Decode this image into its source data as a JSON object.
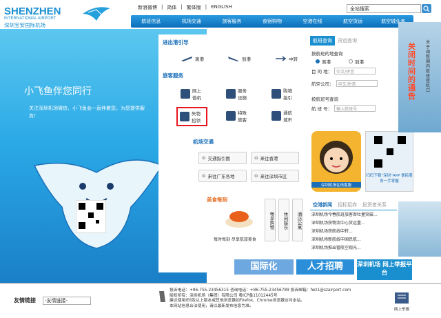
{
  "header": {
    "logo_en": "SHENZHEN",
    "logo_sub": "INTERNATIONAL AIRPORT",
    "logo_cn": "深圳宝安国际机场",
    "top_links": [
      "新浪微博",
      "简体",
      "繁体版",
      "ENGLISH"
    ],
    "search_placeholder": "全站搜索"
  },
  "main_nav": [
    "航班信息",
    "机场交通",
    "旅客服务",
    "食宿购物",
    "空港在线",
    "航空货运",
    "航空城业务"
  ],
  "hero": {
    "title": "小飞鱼伴您同行",
    "subtitle": "关注深圳机场微信、小飞鱼会一直伴着您，为您提供服务！"
  },
  "guide": {
    "title": "进出港引导",
    "items": [
      "离港",
      "到港",
      "中转"
    ]
  },
  "services": {
    "title": "旅客服务",
    "items": [
      "网上值机",
      "服务设施",
      "购物指引",
      "失物招领",
      "特殊旅客",
      "通航城市"
    ]
  },
  "traffic": {
    "title": "机场交通",
    "items": [
      "交通指引图",
      "来往香港",
      "来往广东各地",
      "来往深圳市区"
    ]
  },
  "food": {
    "title": "美食每刻",
    "caption": "每时每刻 尽享航旅美食",
    "vertical": [
      "畅享购物",
      "休闲娱乐",
      "酒店公寓"
    ]
  },
  "flight_query": {
    "tab_active": "航班查询",
    "tab_other": "货运查询",
    "by_city_label": "按航班的地查询",
    "radio_depart": "离港",
    "radio_arrive": "到港",
    "dest_label": "目 的 地：",
    "dest_placeholder": "中文/拼音",
    "company_label": "航空公司：",
    "company_placeholder": "中文/拼音",
    "by_number_label": "按航班号查询",
    "number_label": "航 班 号：",
    "number_placeholder": "输入航班号"
  },
  "cs": {
    "caption": "深圳机场在线客服",
    "qr_caption": "扫码下载“深圳”APP 便民服务一手掌握"
  },
  "news": {
    "tabs": [
      "空港新闻",
      "招标招商",
      "投资者关系"
    ],
    "items": [
      "深圳机场今春航班旅客吞吐量突破...",
      "深圳机场获物流中心货运量...",
      "深圳机场获航线中转...",
      "深圳机场新航线中国民航...",
      "深圳机场推出管航空观光..."
    ]
  },
  "banners": {
    "intl": "国际化",
    "talent": "人才招聘",
    "report": "深圳机场 网上举报平台"
  },
  "sidebar_ad": {
    "top_text": "关闭时间的通告",
    "small_text": "关于调整国内航班登机口"
  },
  "footer": {
    "friend_links": "友情链接",
    "select_default": "-友情链接-",
    "info_line1": "投诉电话：+86-755-23456315  咨询电话：+86-755-23456789  投诉邮箱：fwz1@szairport.com",
    "info_line2": "版权所有：深圳机场（集团）有限公司  粤ICP备11012445号",
    "info_line3": "建议使用IE8及以上版本或其他浏览器如Firefox、Chrome浏览器访问本站。",
    "info_line4": "本网站信息合法使用，请以最新发布信息为准。",
    "report_label": "网上举报"
  },
  "colors": {
    "brand_blue": "#1a8fd0",
    "nav_blue": "#0b6eb8",
    "accent_red": "#ff4a2a"
  }
}
